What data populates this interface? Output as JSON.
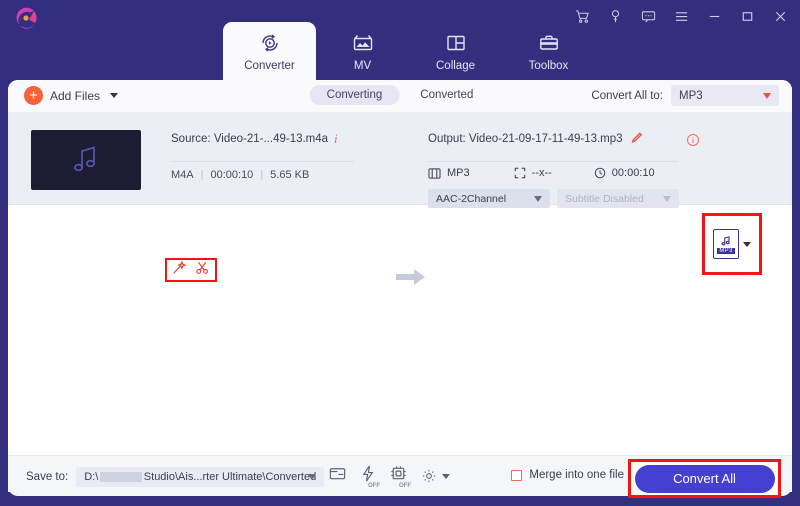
{
  "window": {
    "controls": [
      {
        "name": "cart-icon",
        "label": "Cart"
      },
      {
        "name": "key-icon",
        "label": "Register"
      },
      {
        "name": "feedback-icon",
        "label": "Feedback"
      },
      {
        "name": "menu-icon",
        "label": "Menu"
      },
      {
        "name": "minimize-icon",
        "label": "Minimize"
      },
      {
        "name": "maximize-icon",
        "label": "Maximize"
      },
      {
        "name": "close-icon",
        "label": "Close"
      }
    ]
  },
  "tabs": [
    {
      "label": "Converter",
      "icon": "converter-icon",
      "active": true
    },
    {
      "label": "MV",
      "icon": "mv-icon",
      "active": false
    },
    {
      "label": "Collage",
      "icon": "collage-icon",
      "active": false
    },
    {
      "label": "Toolbox",
      "icon": "toolbox-icon",
      "active": false
    }
  ],
  "toolbar": {
    "add_files_label": "Add Files",
    "segments": [
      {
        "label": "Converting",
        "active": true
      },
      {
        "label": "Converted",
        "active": false
      }
    ],
    "convert_all_to_label": "Convert All to:",
    "convert_all_to_value": "MP3"
  },
  "file": {
    "source_label": "Source: Video-21-...49-13.m4a",
    "format": "M4A",
    "duration": "00:00:10",
    "size": "5.65 KB",
    "edit_tools": [
      {
        "name": "magic-wand-icon",
        "label": "Edit"
      },
      {
        "name": "scissors-icon",
        "label": "Trim"
      }
    ],
    "output_label": "Output: Video-21-09-17-11-49-13.mp3",
    "output_format": "MP3",
    "output_resolution": "--x--",
    "output_duration": "00:00:10",
    "audio_codec": "AAC-2Channel",
    "subtitle": "Subtitle Disabled",
    "format_badge": "MP3"
  },
  "bottom": {
    "save_to_label": "Save to:",
    "save_to_path_prefix": "D:\\",
    "save_to_path_suffix": "Studio\\Ais...rter Ultimate\\Converted",
    "icons": [
      {
        "name": "open-folder-icon",
        "state": ""
      },
      {
        "name": "hardware-acceleration-icon",
        "state": "OFF"
      },
      {
        "name": "gpu-acceleration-icon",
        "state": "OFF"
      },
      {
        "name": "settings-gear-icon",
        "state": ""
      }
    ],
    "merge_label": "Merge into one file",
    "convert_all_button": "Convert All"
  },
  "colors": {
    "header": "#332e7e",
    "accent": "#4540cf",
    "highlight": "#f31414",
    "orange": "#f4623a"
  }
}
